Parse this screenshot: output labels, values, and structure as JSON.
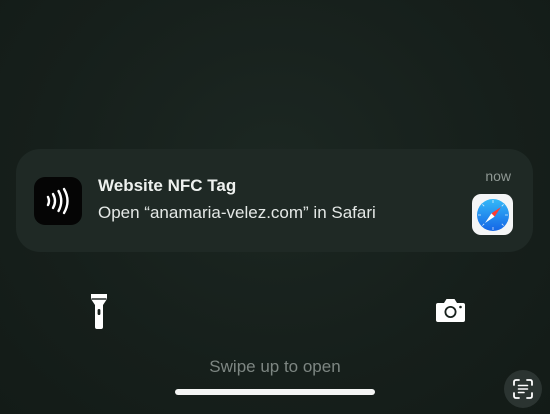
{
  "notification": {
    "title": "Website NFC Tag",
    "body": "Open “anamaria-velez.com” in Safari",
    "time": "now",
    "app_icon": "nfc-icon",
    "action_app_icon": "safari-compass-icon"
  },
  "lockscreen": {
    "swipe_hint": "Swipe up to open",
    "left_quick_action": "flashlight-icon",
    "right_quick_action": "camera-icon",
    "corner_action": "text-scan-icon"
  },
  "colors": {
    "background": "#17201c",
    "notification_bg": "#1f2925",
    "safari_blue": "#1a8cf0"
  }
}
